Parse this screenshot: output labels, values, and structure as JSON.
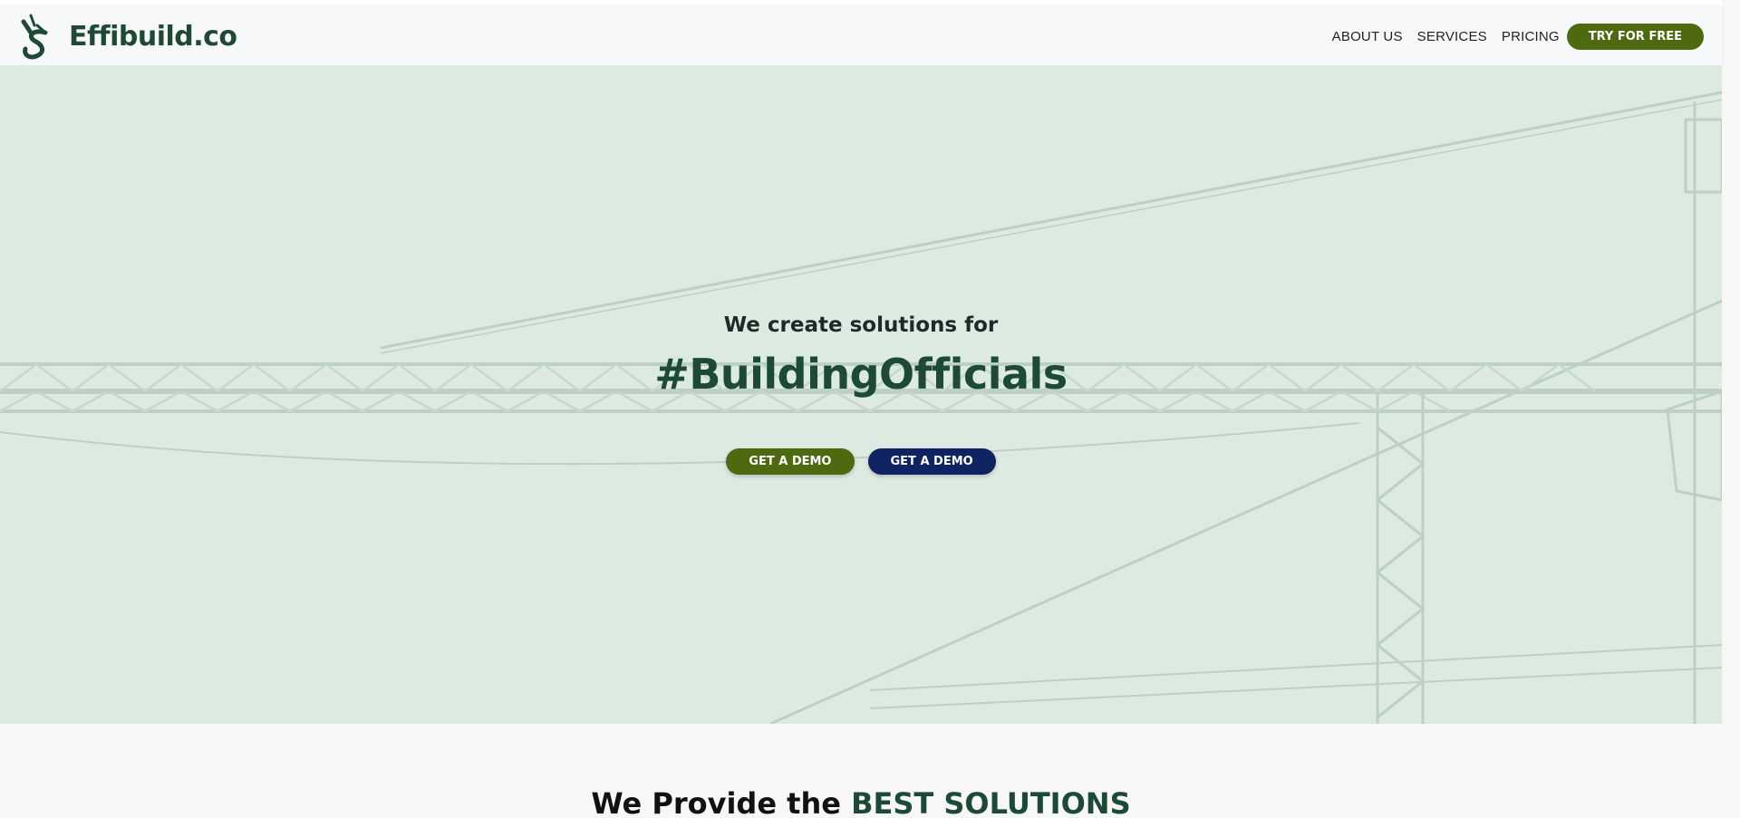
{
  "header": {
    "brand_name": "Effibuild.co",
    "nav": {
      "about": "ABOUT US",
      "services": "SERVICES",
      "pricing": "PRICING",
      "cta": "TRY FOR FREE"
    }
  },
  "hero": {
    "subtitle": "We create solutions for",
    "title": "#BuildingOfficials",
    "primary_button": "GET A DEMO",
    "secondary_button": "GET A DEMO"
  },
  "section": {
    "title_prefix": "We Provide the ",
    "title_accent": "BEST SOLUTIONS"
  },
  "colors": {
    "brand_dark_green": "#1c4a37",
    "button_green": "#4d6a10",
    "button_navy": "#0f2362",
    "hero_background": "#dceae2"
  },
  "icons": {
    "logo": "effibuild-logo-icon"
  }
}
